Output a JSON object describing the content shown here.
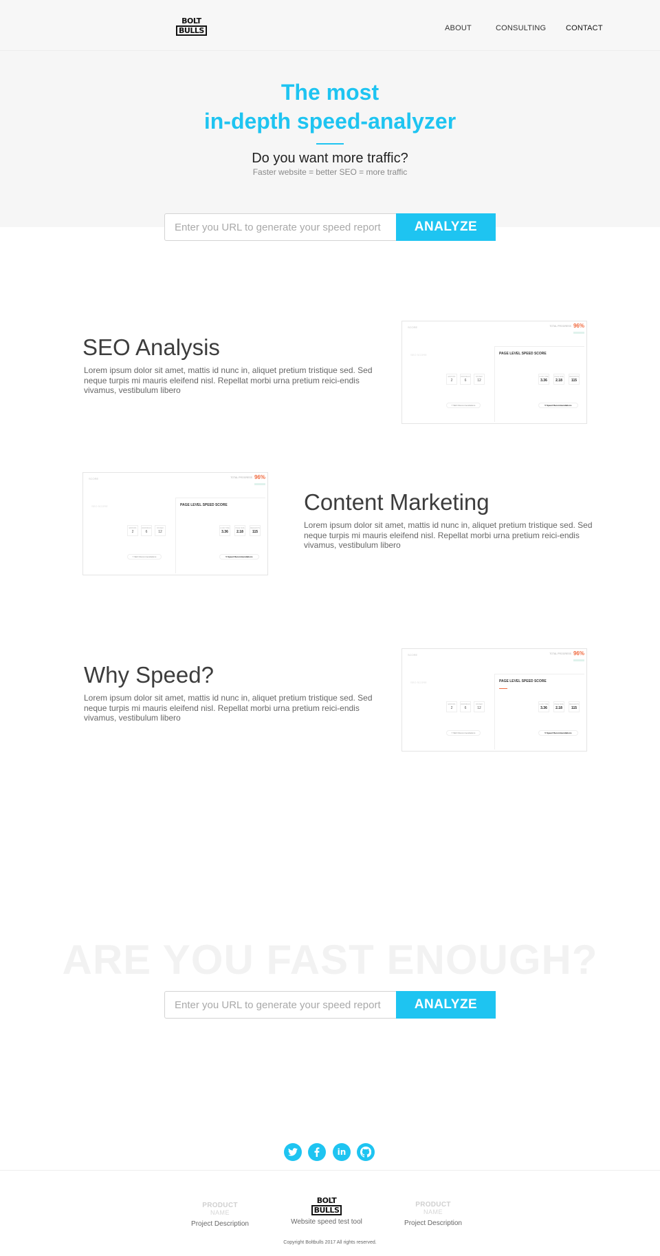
{
  "brand": {
    "line1": "BOLT",
    "line2": "BULLS"
  },
  "nav": {
    "about": "ABOUT",
    "consulting": "CONSULTING",
    "contact": "CONTACT"
  },
  "hero": {
    "title_line1": "The most",
    "title_line2": "in-depth speed-analyzer",
    "subtitle": "Do you want more traffic?",
    "tagline": "Faster website = better SEO = more traffic"
  },
  "search": {
    "placeholder": "Enter you URL to generate your speed report",
    "button": "ANALYZE"
  },
  "features": [
    {
      "title": "SEO Analysis",
      "text": "Lorem ipsum dolor sit amet, mattis id nunc in, aliquet pretium tristique sed. Sed neque turpis mi mauris eleifend nisl. Repellat morbi urna pretium reici-endis vivamus, vestibulum libero"
    },
    {
      "title": "Content Marketing",
      "text": "Lorem ipsum dolor sit amet, mattis id nunc in, aliquet pretium tristique sed. Sed neque turpis mi mauris eleifend nisl. Repellat morbi urna pretium reici-endis vivamus, vestibulum libero"
    },
    {
      "title": "Why Speed?",
      "text": "Lorem ipsum dolor sit amet, mattis id nunc in, aliquet pretium tristique sed. Sed neque turpis mi mauris eleifend nisl. Repellat morbi urna pretium reici-endis vivamus, vestibulum libero"
    }
  ],
  "preview": {
    "top_text": "SCORE",
    "overall_label": "TOTAL PROGRESS",
    "overall_percent": "96%",
    "left_title": "SEO SCORE",
    "panel_title": "PAGE LEVEL SPEED SCORE",
    "left_metrics": [
      {
        "label": "ERRORS",
        "value": "2"
      },
      {
        "label": "WARNINGS",
        "value": "6"
      },
      {
        "label": "PASSED",
        "value": "12"
      }
    ],
    "right_metrics": [
      {
        "label": "LOAD TIME",
        "value": "3.36"
      },
      {
        "label": "PAGE SIZE",
        "value": "2.18"
      },
      {
        "label": "REQUESTS",
        "value": "115"
      }
    ],
    "left_button": "7 SEO Recommendations",
    "right_button": "5 Speed Recommendations",
    "accent": "#f06a3f"
  },
  "cta": {
    "heading": "ARE YOU FAST ENOUGH?"
  },
  "social": [
    "twitter-icon",
    "facebook-icon",
    "linkedin-icon",
    "github-icon"
  ],
  "footer": {
    "col1": {
      "name_top": "PRODUCT",
      "name_bottom": "NAME",
      "desc": "Project Description"
    },
    "col2": {
      "desc": "Website speed test tool"
    },
    "col3": {
      "name_top": "PRODUCT",
      "name_bottom": "NAME",
      "desc": "Project Description"
    },
    "copyright": "Copyright Boltbulls 2017 All rights reserved."
  },
  "colors": {
    "accent": "#1ec4f1",
    "hero_bg": "#f6f6f6",
    "warning": "#f06a3f"
  }
}
